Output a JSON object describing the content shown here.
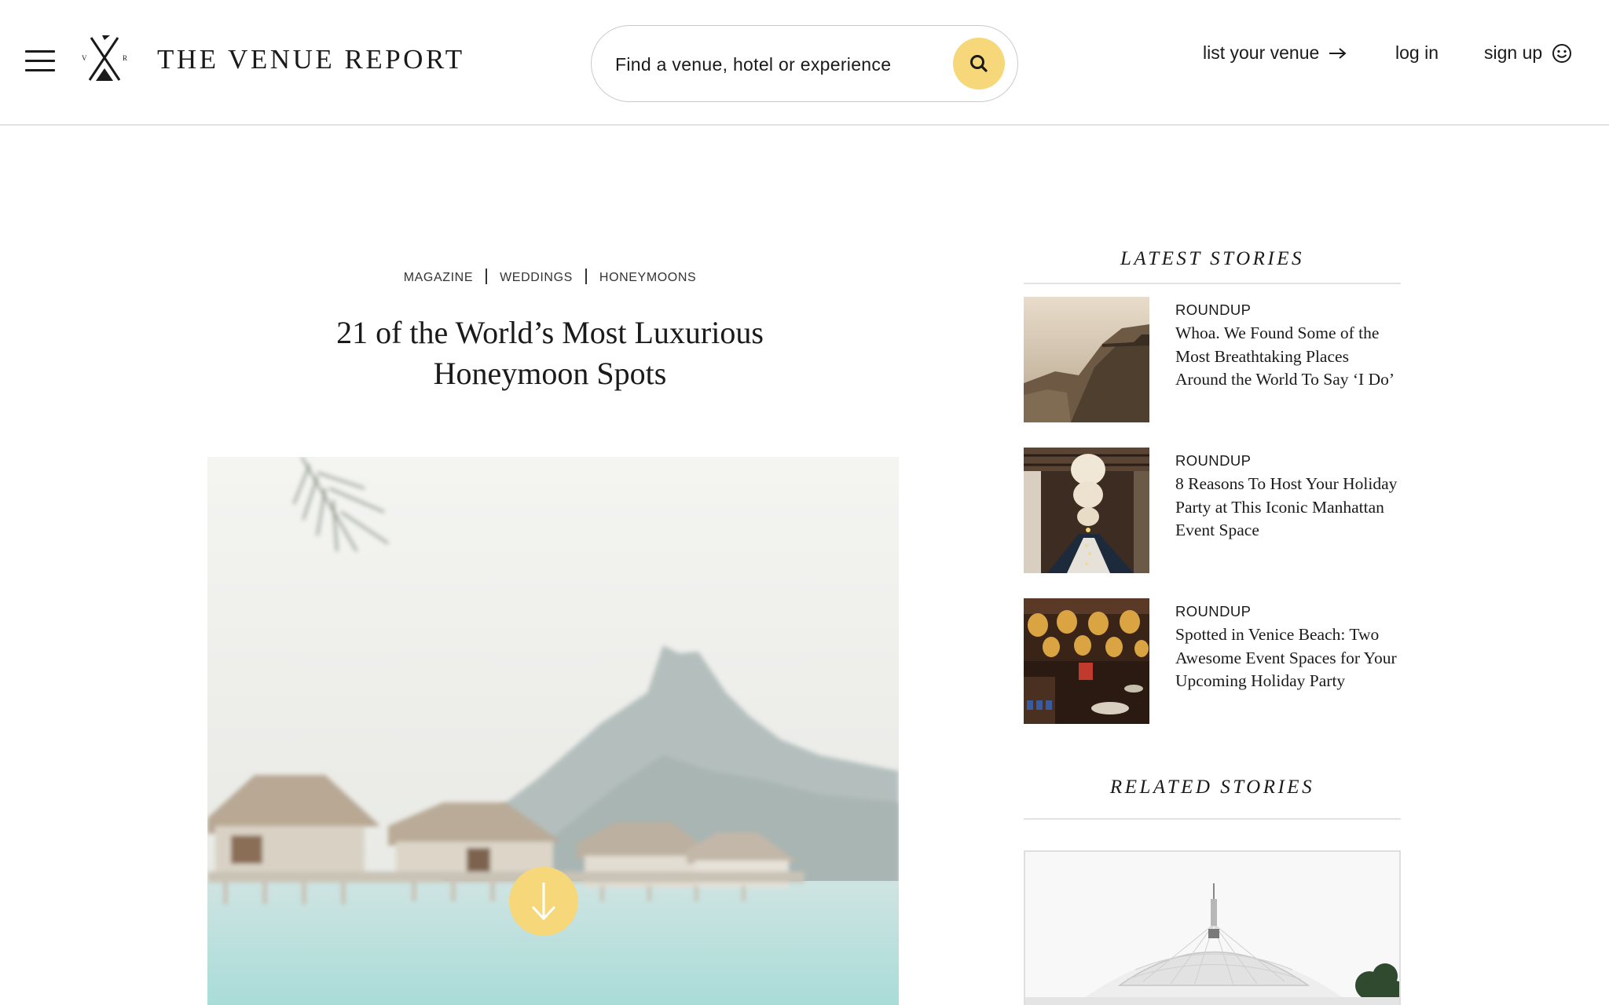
{
  "header": {
    "brand": "THE VENUE REPORT",
    "logo_letters": {
      "left": "V",
      "right": "R"
    },
    "search": {
      "placeholder": "Find a venue, hotel or experience"
    },
    "nav": {
      "list_venue": "list your venue",
      "login": "log in",
      "signup": "sign up"
    }
  },
  "article": {
    "breadcrumbs": [
      "MAGAZINE",
      "WEDDINGS",
      "HONEYMOONS"
    ],
    "title_line1": "21 of the World’s Most Luxurious",
    "title_line2": "Honeymoon Spots"
  },
  "sidebar": {
    "latest_heading": "LATEST STORIES",
    "related_heading": "RELATED STORIES",
    "stories": [
      {
        "kicker": "ROUNDUP",
        "headline": "Whoa. We Found Some of the Most Breathtaking Places Around the World To Say ‘I Do’"
      },
      {
        "kicker": "ROUNDUP",
        "headline": "8 Reasons To Host Your Holiday Party at This Iconic Manhattan Event Space"
      },
      {
        "kicker": "ROUNDUP",
        "headline": "Spotted in Venice Beach: Two Awesome Event Spaces for Your Upcoming Holiday Party"
      }
    ]
  },
  "colors": {
    "accent": "#f6d77a",
    "text": "#1a1a1a",
    "divider": "#e2e2e2"
  },
  "icons": {
    "menu": "hamburger-menu-icon",
    "search": "search-icon",
    "arrow": "arrow-right-icon",
    "smile": "smiley-icon",
    "scroll": "arrow-down-icon"
  }
}
